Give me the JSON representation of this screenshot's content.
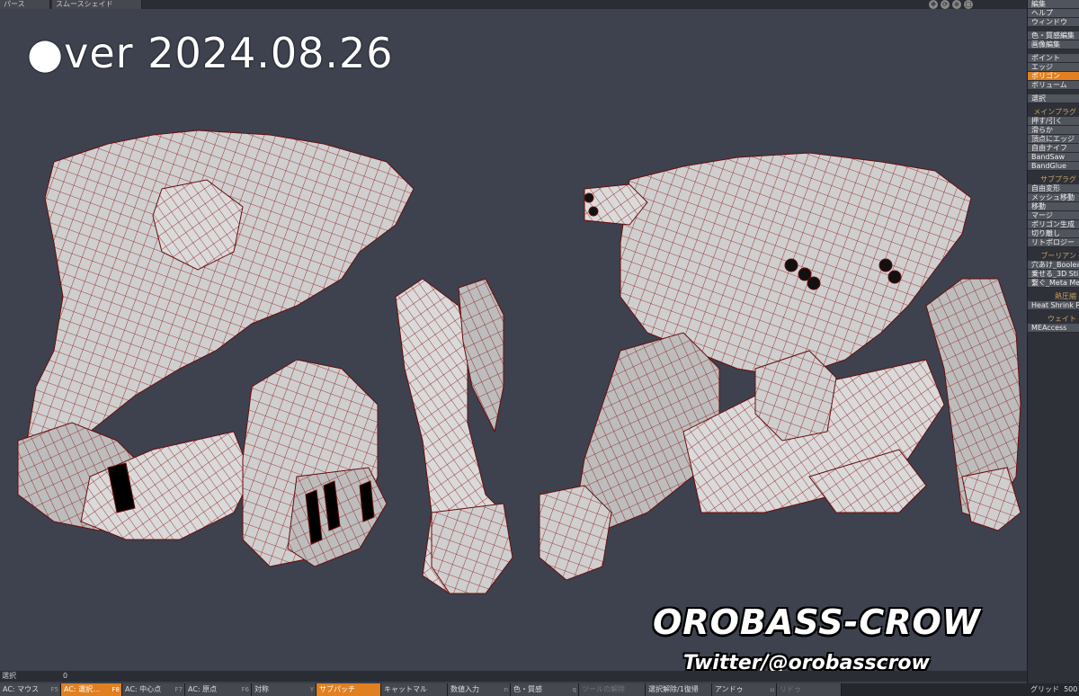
{
  "topbar": {
    "dropdown1": "パース",
    "dropdown2": "スムースシェイド"
  },
  "overlay": {
    "version": "●ver 2024.08.26",
    "brand": "OROBASS-CROW",
    "twitter": "Twitter/@orobasscrow"
  },
  "right_panel": {
    "top": [
      "編集",
      "ヘルプ",
      "ウィンドウ"
    ],
    "edit": [
      "色・質感編集",
      "画像編集"
    ],
    "modes": [
      "ポイント",
      "エッジ",
      "ポリゴン",
      "ボリューム"
    ],
    "active_mode": "ポリゴン",
    "select": "選択",
    "main_plugin_title": "メインプラグ",
    "main_plugins": [
      "押す/引く",
      "滑らか",
      "頂点にエッジ",
      "自由ナイフ",
      "BandSaw",
      "BandGlue"
    ],
    "sub_plugin_title": "サブプラグ",
    "sub_plugins": [
      "自由変形",
      "メッシュ移動",
      "移動",
      "マージ",
      "ポリゴン生成",
      "切り離し",
      "リトポロジー"
    ],
    "boolean_title": "ブーリアン",
    "booleans": [
      "穴あけ_Boolea",
      "乗せる_3D Sti",
      "繋ぐ_Meta Me"
    ],
    "heat_title": "熱圧縮",
    "heat": [
      "Heat Shrink P"
    ],
    "weight_title": "ウェイト",
    "weight": [
      "MEAccess"
    ]
  },
  "statusbar": {
    "select_label": "選択",
    "select_count": "0"
  },
  "bottom_bar": [
    {
      "label": "AC: マウス",
      "key": "F5"
    },
    {
      "label": "AC: 選択…",
      "key": "F8",
      "active": true
    },
    {
      "label": "AC: 中心点",
      "key": "F7"
    },
    {
      "label": "AC: 原点",
      "key": "F6"
    },
    {
      "label": "対称",
      "key": "Y"
    },
    {
      "label": "サブパッチ",
      "key": "",
      "active": true
    },
    {
      "label": "キャットマル",
      "key": ""
    },
    {
      "label": "数値入力",
      "key": "n"
    },
    {
      "label": "色・質感",
      "key": "q"
    },
    {
      "label": "ツールの解除",
      "key": "",
      "dim": true
    },
    {
      "label": "選択解除/1復帰",
      "key": ""
    },
    {
      "label": "アンドゥ",
      "key": "u"
    },
    {
      "label": "リドゥ",
      "key": "",
      "dim": true
    }
  ],
  "grid": {
    "label": "グリッド",
    "value": "500"
  },
  "colors": {
    "viewport": "#3d424e",
    "wire": "#8a1010",
    "mesh_face": "#c9c9c9",
    "active": "#e08020"
  }
}
